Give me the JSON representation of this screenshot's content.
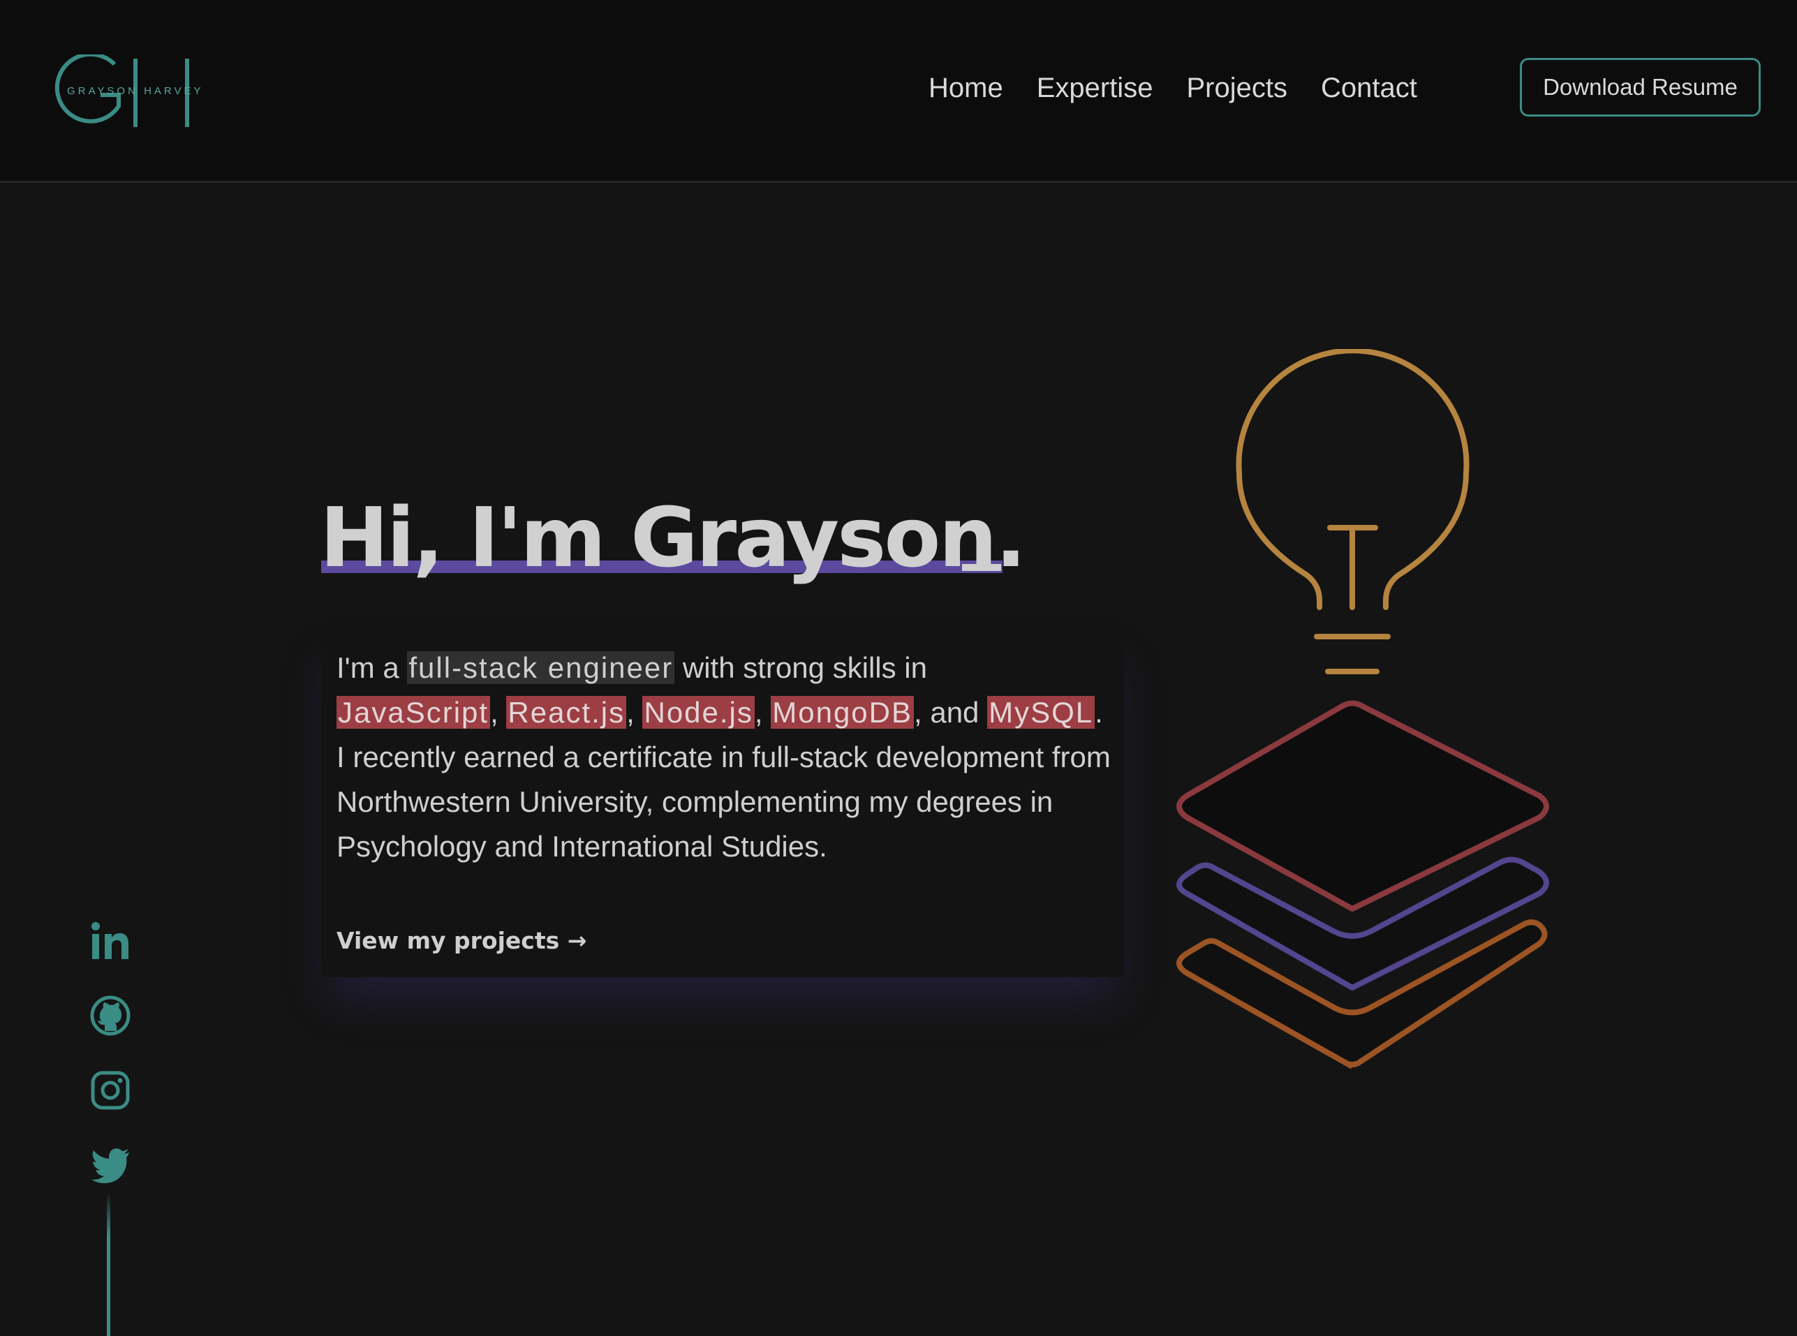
{
  "header": {
    "logo_letters": "GH",
    "logo_subtitle": "GRAYSON HARVEY",
    "nav": [
      {
        "label": "Home"
      },
      {
        "label": "Expertise"
      },
      {
        "label": "Projects"
      },
      {
        "label": "Contact"
      }
    ],
    "resume_button": "Download Resume"
  },
  "hero": {
    "title": "Hi, I'm Grayson.",
    "intro": {
      "prefix": "I'm a ",
      "role": "full-stack engineer",
      "after_role": " with strong skills in",
      "skills": [
        "JavaScript",
        "React.js",
        "Node.js",
        "MongoDB",
        "MySQL"
      ],
      "sep_comma": ",",
      "sep_and": ", and",
      "period": ".",
      "rest": "I recently earned a certificate in full-stack development from Northwestern University, complementing my degrees in Psychology and International Studies."
    },
    "cta": "View my projects →"
  },
  "social": [
    {
      "icon": "linkedin-icon"
    },
    {
      "icon": "github-icon"
    },
    {
      "icon": "instagram-icon"
    },
    {
      "icon": "twitter-icon"
    }
  ],
  "colors": {
    "background": "#141414",
    "header_bg": "#0c0c0c",
    "accent_teal": "#3a8c84",
    "accent_purple": "#5b4a9e",
    "highlight_red": "#9c3e44",
    "bulb_gold": "#b5843f",
    "layer_red": "#8a3a3e",
    "layer_purple": "#54458f",
    "layer_orange": "#9c5424"
  }
}
